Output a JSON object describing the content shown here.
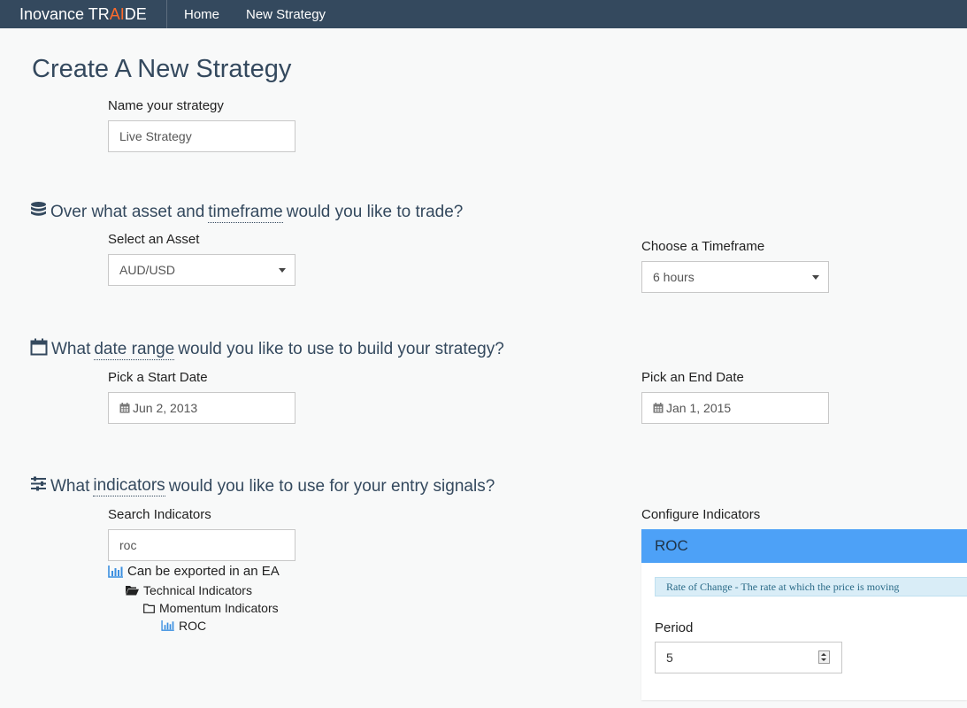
{
  "nav": {
    "brand_prefix": "Inovance TR",
    "brand_highlight": "AI",
    "brand_suffix": "DE",
    "links": [
      "Home",
      "New Strategy"
    ]
  },
  "page_title": "Create A New Strategy",
  "name_section": {
    "label": "Name your strategy",
    "value": "Live Strategy"
  },
  "asset_section": {
    "heading_pre": "Over what asset and ",
    "heading_link": "timeframe",
    "heading_post": " would you like to trade?",
    "asset_label": "Select an Asset",
    "asset_value": "AUD/USD",
    "timeframe_label": "Choose a Timeframe",
    "timeframe_value": "6 hours"
  },
  "date_section": {
    "heading_pre": "What ",
    "heading_link": "date range",
    "heading_post": " would you like to use to build your strategy?",
    "start_label": "Pick a Start Date",
    "start_value": "Jun 2, 2013",
    "end_label": "Pick an End Date",
    "end_value": "Jan 1, 2015"
  },
  "indicator_section": {
    "heading_pre": "What ",
    "heading_link": "indicators",
    "heading_post": " would you like to use for your entry signals?",
    "search_label": "Search Indicators",
    "search_value": "roc",
    "legend": "Can be exported in an EA",
    "tree": [
      "Technical Indicators",
      "Momentum Indicators",
      "ROC"
    ],
    "config_label": "Configure Indicators",
    "panel_title": "ROC",
    "panel_info": "Rate of Change - The rate at which the price is moving",
    "param_label": "Period",
    "param_value": "5"
  },
  "colors": {
    "navbar": "#34495e",
    "brand_accent": "#ff6a2a",
    "panel_header": "#4da1f7",
    "info_bg": "#d9edf7",
    "chart_icon": "#3b8fe0"
  }
}
